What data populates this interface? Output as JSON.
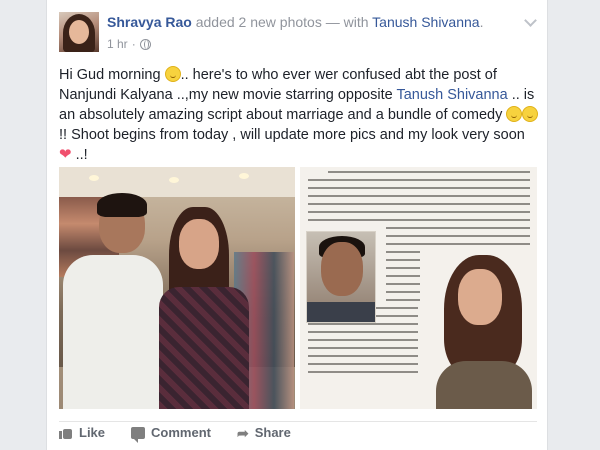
{
  "post": {
    "author": "Shravya Rao",
    "action": "added 2 new photos",
    "with_sep": "— with",
    "tagged": "Tanush Shivanna",
    "time": "1 hr",
    "separator": "·",
    "text_part1": "Hi Gud morning ",
    "text_part2": ".. here's to who ever wer confused abt the post of Nanjundi Kalyana ..,my new movie starring opposite ",
    "text_link": "Tanush Shivanna",
    "text_part3": " .. is an absolutely amazing script about marriage and a bundle of comedy ",
    "text_part4": " !! Shoot begins from today , will update more pics and my look very soon ",
    "text_part5": " ..!"
  },
  "actions": {
    "like": "Like",
    "comment": "Comment",
    "share": "Share"
  },
  "icons": {
    "audience": "globe-icon",
    "menu": "chevron-down-icon",
    "like": "thumbs-up-icon",
    "comment": "comment-icon",
    "share": "share-arrow-icon"
  },
  "colors": {
    "link": "#365899",
    "meta": "#90949c",
    "text": "#1d2129",
    "action": "#616770",
    "background": "#e9ebee"
  }
}
